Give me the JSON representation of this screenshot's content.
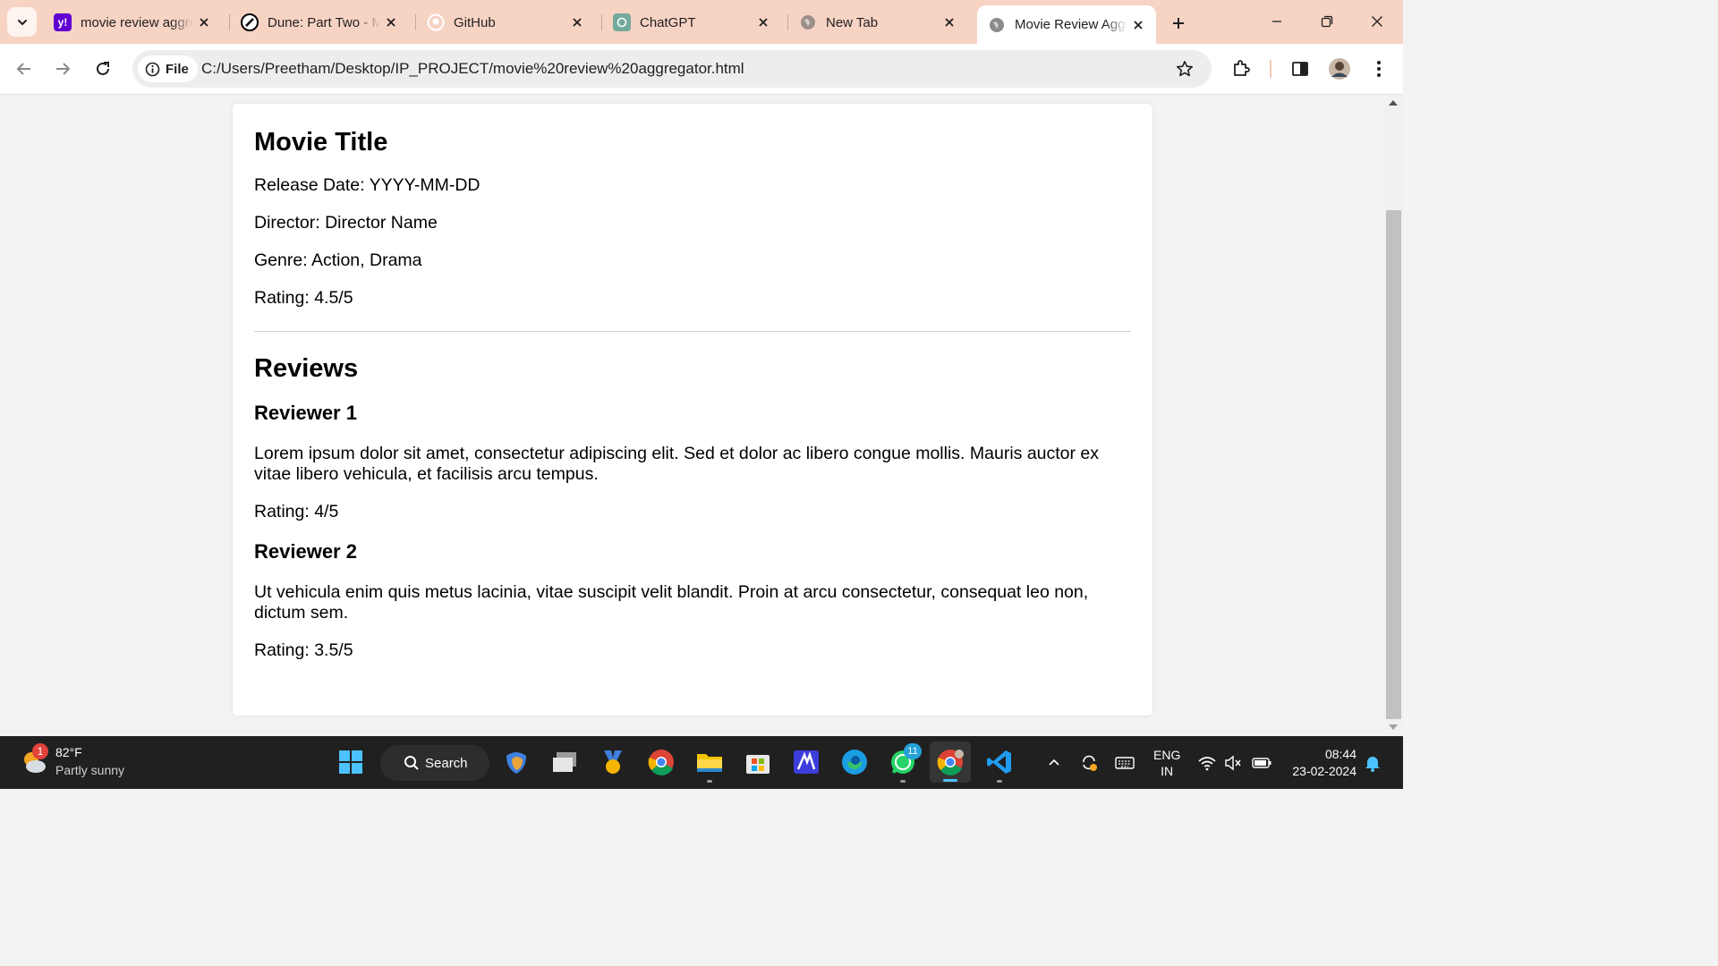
{
  "browser": {
    "tabs": [
      {
        "title": "movie review aggregator - Yahoo Search",
        "favicon": "yahoo-icon"
      },
      {
        "title": "Dune: Part Two - Movie",
        "favicon": "dune-icon"
      },
      {
        "title": "GitHub",
        "favicon": "github-icon"
      },
      {
        "title": "ChatGPT",
        "favicon": "chatgpt-icon"
      },
      {
        "title": "New Tab",
        "favicon": "globe-icon"
      },
      {
        "title": "Movie Review Aggregator",
        "favicon": "globe-icon",
        "active": true
      }
    ],
    "site_chip_label": "File",
    "url": "C:/Users/Preetham/Desktop/IP_PROJECT/movie%20review%20aggregator.html",
    "accent_color": "#f7d3c4"
  },
  "page": {
    "movie_title": "Movie Title",
    "release_date": "Release Date: YYYY-MM-DD",
    "director": "Director: Director Name",
    "genre": "Genre: Action, Drama",
    "rating": "Rating: 4.5/5",
    "reviews_heading": "Reviews",
    "reviews": [
      {
        "reviewer": "Reviewer 1",
        "text": "Lorem ipsum dolor sit amet, consectetur adipiscing elit. Sed et dolor ac libero congue mollis. Mauris auctor ex vitae libero vehicula, et facilisis arcu tempus.",
        "rating": "Rating: 4/5"
      },
      {
        "reviewer": "Reviewer 2",
        "text": "Ut vehicula enim quis metus lacinia, vitae suscipit velit blandit. Proin at arcu consectetur, consequat leo non, dictum sem.",
        "rating": "Rating: 3.5/5"
      }
    ]
  },
  "taskbar": {
    "weather_temp": "82°F",
    "weather_desc": "Partly sunny",
    "weather_badge": "1",
    "search_label": "Search",
    "whatsapp_badge": "11",
    "language_line1": "ENG",
    "language_line2": "IN",
    "time": "08:44",
    "date": "23-02-2024"
  }
}
